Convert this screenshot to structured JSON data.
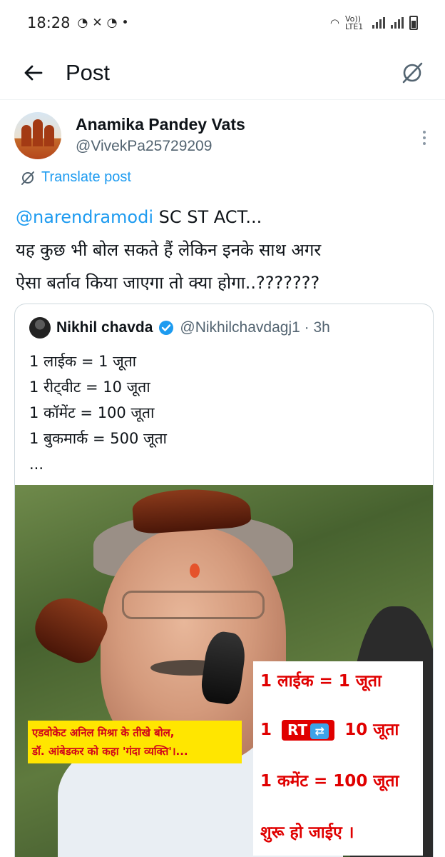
{
  "status_bar": {
    "time": "18:28",
    "notif_icons": [
      "whatsapp-icon",
      "missed-call-icon",
      "whatsapp-icon"
    ],
    "network": "Vo)) LTE1"
  },
  "header": {
    "title": "Post"
  },
  "post": {
    "author_name": "Anamika Pandey Vats",
    "author_handle": "@VivekPa25729209",
    "translate_label": "Translate post",
    "mention": "@narendramodi",
    "line1_rest": " SC ST ACT...",
    "line2": " यह कुछ भी बोल सकते हैं लेकिन इनके साथ अगर",
    "line3": "ऐसा बर्ताव किया जाएगा तो क्या होगा..???????"
  },
  "quote": {
    "name": "Nikhil chavda",
    "handle": "@Nikhilchavdagj1 · 3h",
    "lines": [
      "1 लाईक = 1 जूता",
      "1 रीट्वीट = 10 जूता",
      "1 कॉमेंट  = 100 जूता",
      "1 बुकमार्क = 500 जूता",
      "..."
    ],
    "image": {
      "caption_line1": "एडवोकेट अनिल मिश्रा के तीखे बोल,",
      "caption_line2": "डॉ. आंबेडकर को कहा 'गंदा व्यक्ति'।...",
      "card_line1": "1 लाईक = 1 जूता",
      "card_line2_pre": "1",
      "card_rt": "RT",
      "card_line2_post": "10 जूता",
      "card_line3": "1 कमेंट = 100 जूता",
      "card_line4": "शुरू हो जाईए ।"
    }
  },
  "colors": {
    "accent": "#1d9bf0",
    "secondary_text": "#536471",
    "border": "#cfd9de"
  }
}
